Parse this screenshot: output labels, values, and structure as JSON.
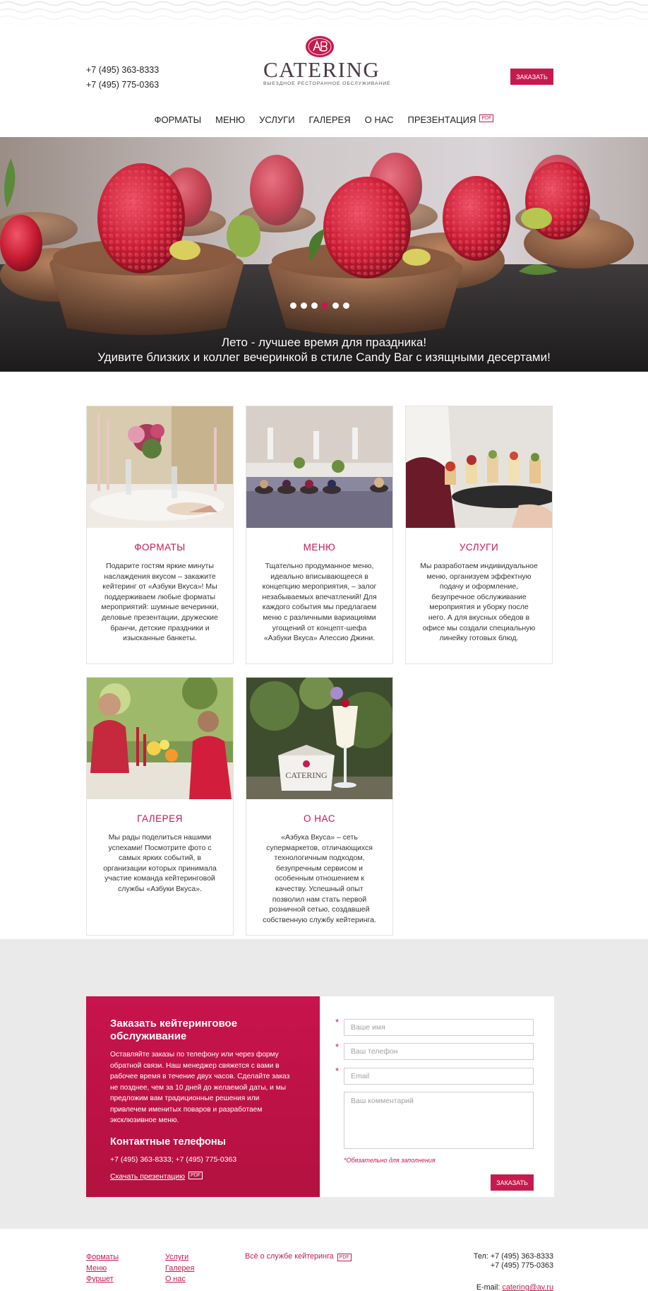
{
  "header": {
    "phone_1": "+7 (495) 363-8333",
    "phone_2": "+7 (495) 775-0363",
    "logo_word": "CATERING",
    "logo_tagline": "ВЫЕЗДНОЕ РЕСТОРАННОЕ ОБСЛУЖИВАНИЕ",
    "order_button": "ЗАКАЗАТЬ"
  },
  "nav": {
    "items": [
      {
        "label": "ФОРМАТЫ"
      },
      {
        "label": "МЕНЮ"
      },
      {
        "label": "УСЛУГИ"
      },
      {
        "label": "ГАЛЕРЕЯ"
      },
      {
        "label": "О НАС"
      },
      {
        "label": "ПРЕЗЕНТАЦИЯ"
      }
    ],
    "pdf_badge": "PDF"
  },
  "hero": {
    "caption_line_1": "Лето - лучшее время для праздника!",
    "caption_line_2": "Удивите близких и коллег вечеринкой в стиле Candy Bar с изящными десертами!",
    "slides_count": 6,
    "active_slide": 4
  },
  "cards": [
    {
      "title": "ФОРМАТЫ",
      "text": "Подарите гостям яркие минуты наслаждения вкусом – закажите кейтеринг от «Азбуки Вкуса»! Мы поддерживаем любые форматы мероприятий: шумные вечеринки, деловые презентации, дружеские бранчи, детские праздники и изысканные банкеты."
    },
    {
      "title": "МЕНЮ",
      "text": "Тщательно продуманное меню, идеально вписывающееся в концепцию мероприятия, – залог незабываемых впечатлений! Для каждого события мы предлагаем меню с различными вариациями угощений от концепт-шефа «Азбуки Вкуса» Алессио Джини."
    },
    {
      "title": "УСЛУГИ",
      "text": "Мы разработаем индивидуальное меню, организуем эффектную подачу и оформление, безупречное обслуживание мероприятия и уборку после него. А для вкусных обедов в офисе мы создали специальную линейку готовых блюд."
    },
    {
      "title": "ГАЛЕРЕЯ",
      "text": "Мы рады поделиться нашими успехами! Посмотрите фото с самых ярких событий, в организации которых принимала участие команда кейтеринговой службы «Азбуки Вкуса»."
    },
    {
      "title": "О НАС",
      "text": "«Азбука Вкуса» – сеть супермаркетов, отличающихся технологичным подходом, безупречным сервисом и особенным отношением к качеству. Успешный опыт позволил нам стать первой розничной сетью, создавшей собственную службу кейтеринга."
    }
  ],
  "order": {
    "title": "Заказать кейтеринговое обслуживание",
    "text": "Оставляйте заказы по телефону или через форму обратной связи. Наш менеджер свяжется с вами в рабочее время в течение двух часов. Сделайте заказ не позднее, чем за 10 дней до желаемой даты, и мы предложим вам традиционные решения или привлечем именитых поваров и разработаем эксклюзивное меню.",
    "contacts_title": "Контактные телефоны",
    "contacts_phones": "+7 (495) 363-8333; +7 (495) 775-0363",
    "presentation_link": "Скачать презентацию",
    "pdf_badge": "PDF",
    "form": {
      "name_placeholder": "Ваше имя",
      "phone_placeholder": "Ваш телефон",
      "email_placeholder": "Email",
      "comment_placeholder": "Ваш комментарий",
      "required_note": "*Обязательно для заполнения",
      "submit": "ЗАКАЗАТЬ",
      "required_mark": "*"
    }
  },
  "footer": {
    "col1": [
      "Форматы",
      "Меню",
      "Фуршет"
    ],
    "col2": [
      "Услуги",
      "Галерея",
      "О нас"
    ],
    "service_link": "Всё о службе кейтеринга",
    "pdf_badge": "PDF",
    "tel_line_1": "Тел: +7 (495) 363-8333",
    "tel_line_2": "+7 (495) 775-0363",
    "email_label": "E-mail:",
    "email": "catering@av.ru"
  },
  "colors": {
    "accent": "#c61a4f",
    "band": "#eaeaea"
  }
}
